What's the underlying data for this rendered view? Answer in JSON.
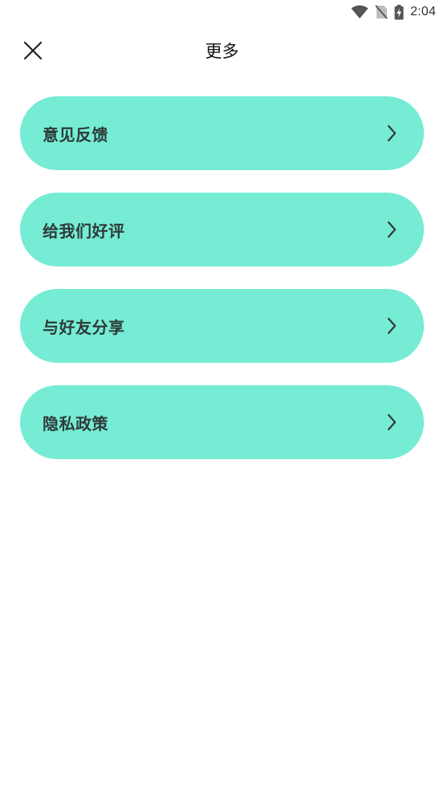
{
  "status_bar": {
    "time": "2:04",
    "icons": [
      "wifi-icon",
      "no-sim-icon",
      "battery-charging-icon"
    ]
  },
  "header": {
    "title": "更多",
    "close_icon": "close-icon"
  },
  "menu": {
    "items": [
      {
        "id": "feedback",
        "label": "意见反馈",
        "icon": "chevron-right-icon"
      },
      {
        "id": "rate-us",
        "label": "给我们好评",
        "icon": "chevron-right-icon"
      },
      {
        "id": "share",
        "label": "与好友分享",
        "icon": "chevron-right-icon"
      },
      {
        "id": "privacy",
        "label": "隐私政策",
        "icon": "chevron-right-icon"
      }
    ]
  },
  "colors": {
    "item_background": "#76ecd5",
    "item_text": "#2f3a37",
    "page_background": "#ffffff"
  }
}
